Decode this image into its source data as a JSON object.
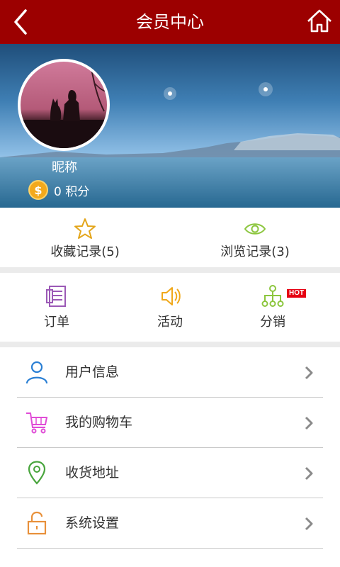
{
  "header": {
    "title": "会员中心",
    "back_icon": "back-arrow-icon",
    "home_icon": "home-icon"
  },
  "profile": {
    "nickname": "昵称",
    "points_text": "0 积分",
    "coin_symbol": "$"
  },
  "stats": [
    {
      "label": "收藏记录(5)",
      "icon": "star-icon",
      "color": "#e3a51a"
    },
    {
      "label": "浏览记录(3)",
      "icon": "eye-icon",
      "color": "#8cc63e"
    }
  ],
  "quick_actions": [
    {
      "label": "订单",
      "icon": "order-icon",
      "color": "#9b59b6"
    },
    {
      "label": "活动",
      "icon": "speaker-icon",
      "color": "#f0a81a"
    },
    {
      "label": "分销",
      "icon": "network-icon",
      "color": "#8cc63e",
      "badge": "HOT"
    }
  ],
  "menu": [
    {
      "label": "用户信息",
      "icon": "user-icon",
      "color": "#2a7fd4"
    },
    {
      "label": "我的购物车",
      "icon": "cart-icon",
      "color": "#e04bd6"
    },
    {
      "label": "收货地址",
      "icon": "location-icon",
      "color": "#49a53d"
    },
    {
      "label": "系统设置",
      "icon": "lock-icon",
      "color": "#e8903a"
    }
  ]
}
